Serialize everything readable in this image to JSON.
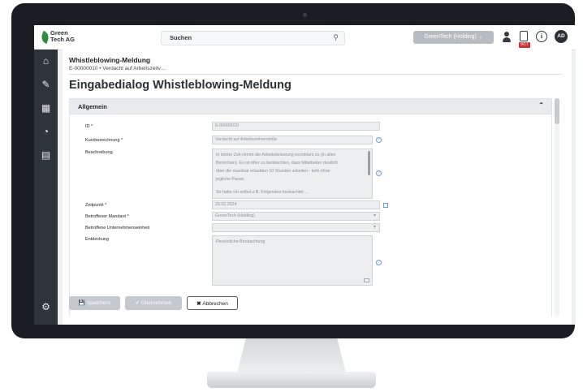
{
  "topbar": {
    "logo_text": "Green\nTech AG",
    "search_label": "Suchen",
    "org_label": "GreenTech (Holding)",
    "badge": "9/17",
    "avatar_initials": "AD"
  },
  "breadcrumb": {
    "title": "Whistleblowing-Meldung",
    "subtitle": "E-00000010 • Verdacht auf Arbeitszeitv…"
  },
  "page_title": "Eingabedialog Whistleblowing-Meldung",
  "section": {
    "label": "Allgemein"
  },
  "fields": {
    "id": {
      "label": "ID *",
      "value": "E-00000010"
    },
    "kurz": {
      "label": "Kurzbezeichnung *",
      "value": "Verdacht auf Arbeitszeitverstöße"
    },
    "beschreibung": {
      "label": "Beschreibung",
      "line1": "In letzter Zeit nimmt die Arbeitsbelastung exorbitant zu (in allen",
      "line2": "Bereichen). Es ist öfter zu beobachten, dass Mitarbeiter deutlich",
      "line3": "über die maximal erlaubten 10 Stunden arbeiten - teils ohne",
      "line4": "jegliche Pause.",
      "line5": "So habe ich selbst z.B. Folgendes beobachtet ..."
    },
    "zeitpunkt": {
      "label": "Zeitpunkt *",
      "value": "29.02.2024"
    },
    "mandant": {
      "label": "Betroffener Mandant *",
      "value": "GreenTech (Holding)"
    },
    "einheit": {
      "label": "Betroffene Unternehmenseinheit",
      "value": ""
    },
    "entdeckung": {
      "label": "Entdeckung",
      "value": "Persönliche Beobachtung"
    }
  },
  "buttons": {
    "save": "Speichern",
    "apply": "Übernehmen",
    "cancel": "Abbrechen"
  }
}
